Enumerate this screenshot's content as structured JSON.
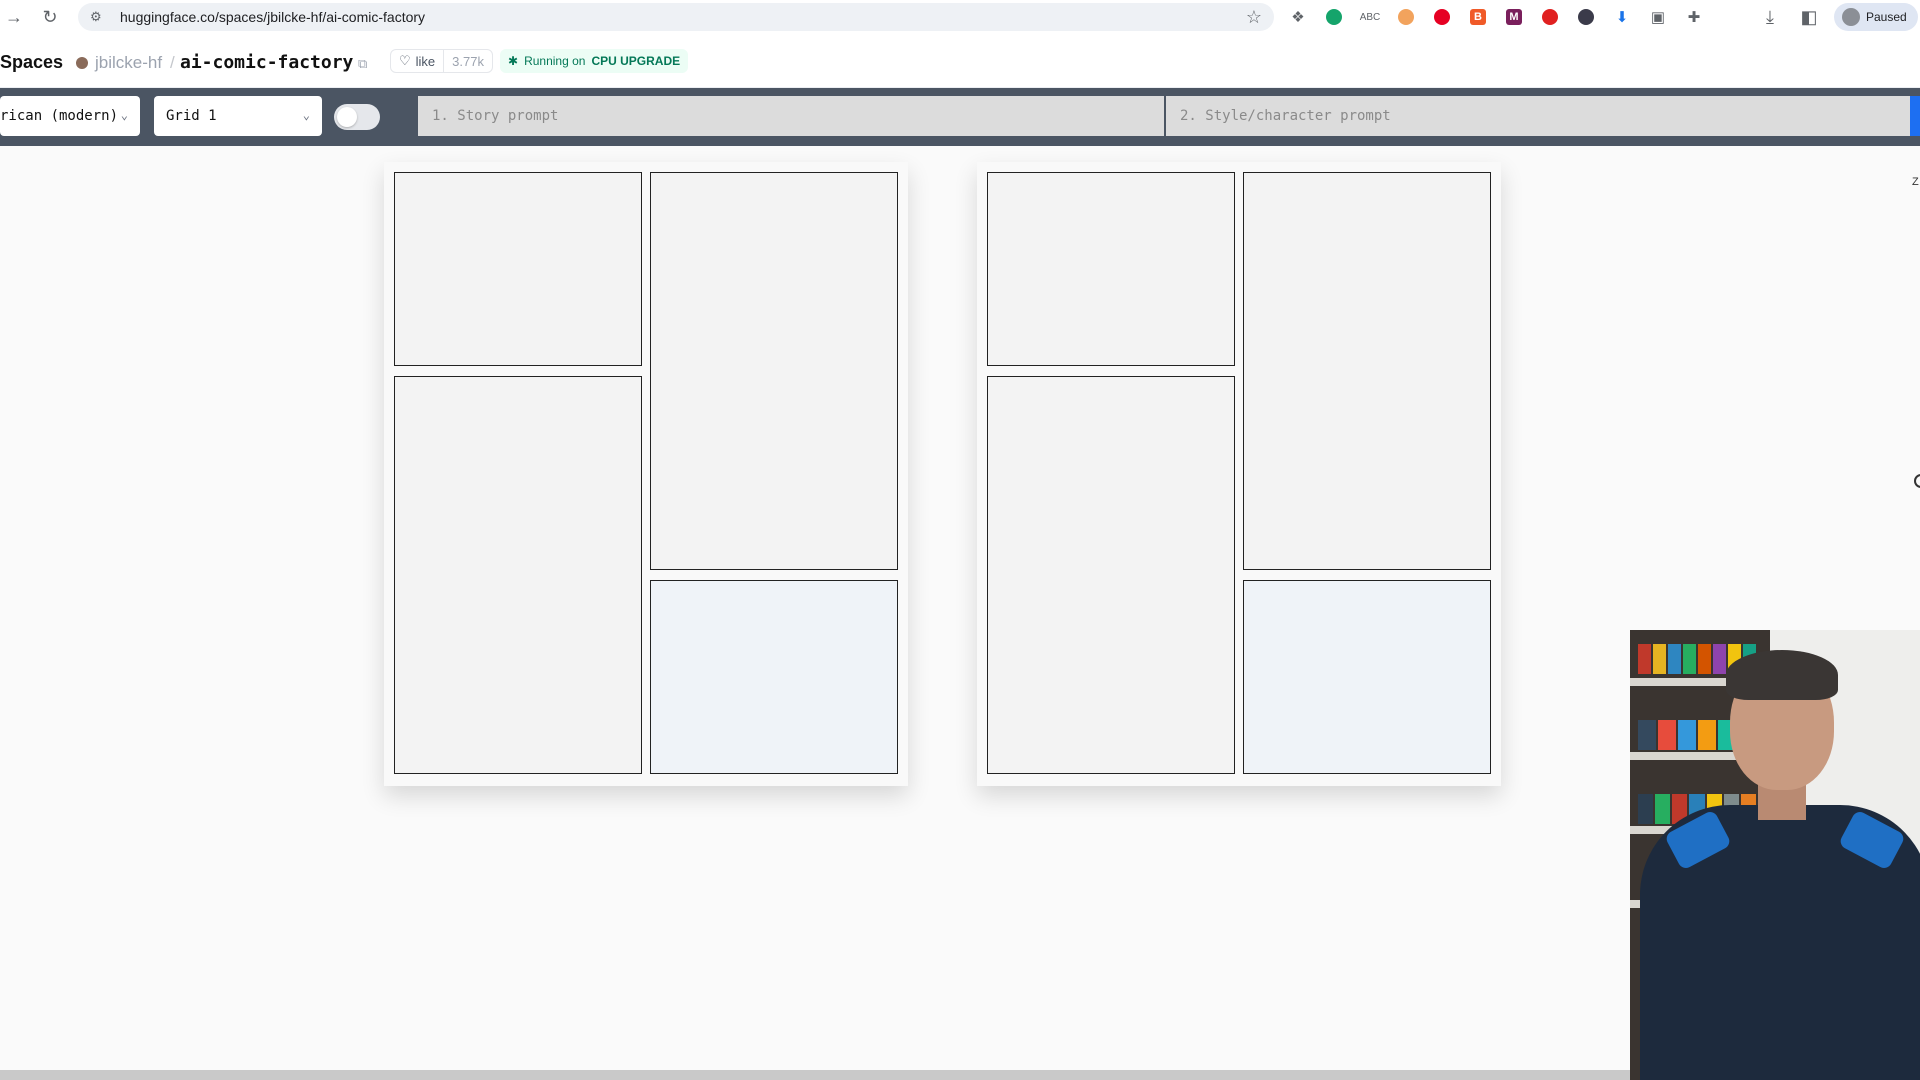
{
  "browser": {
    "url": "huggingface.co/spaces/jbilcke-hf/ai-comic-factory",
    "profile_status": "Paused",
    "extensions": [
      "dropbox-icon",
      "grammarly-icon",
      "abc-icon",
      "tracker-icon",
      "pinterest-icon",
      "b-extension-icon",
      "m-extension-icon",
      "red-dot-icon",
      "dark-circle-icon",
      "download-arrow-icon",
      "reader-icon",
      "puzzle-icon"
    ]
  },
  "hf_header": {
    "section": "Spaces",
    "owner": "jbilcke-hf",
    "separator": "/",
    "repo": "ai-comic-factory",
    "like_label": "like",
    "like_count": "3.77k",
    "status_prefix": "Running on",
    "status_hardware": "CPU UPGRADE"
  },
  "toolbar": {
    "style_select": "rican (modern)",
    "layout_select": "Grid 1",
    "story_prompt_placeholder": "1. Story prompt",
    "style_prompt_placeholder": "2. Style/character prompt"
  },
  "canvas": {
    "pages": [
      {
        "panels": 4
      },
      {
        "panels": 4
      }
    ],
    "side_text": "Z"
  },
  "colors": {
    "toolbar_bg": "#4b5563",
    "accent_blue": "#1d6ff2",
    "status_green": "#047857"
  }
}
